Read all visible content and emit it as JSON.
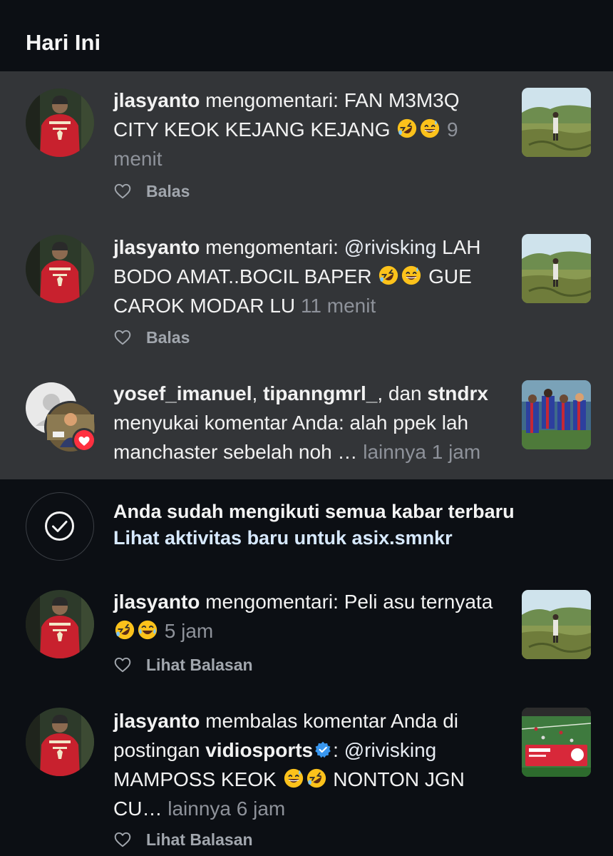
{
  "header": {
    "title": "Hari Ini"
  },
  "notifications": [
    {
      "user": "jlasyanto",
      "action": "mengomentari:",
      "body": "FAN M3M3Q CITY KEOK KEJANG KEJANG",
      "emojis": [
        "rolling-laugh",
        "sweat-smile"
      ],
      "time": "9 menit",
      "reply_label": "Balas"
    },
    {
      "user": "jlasyanto",
      "action": "mengomentari:",
      "mention": "@rivisking",
      "body_a": "LAH BODO AMAT..BOCIL BAPER",
      "emojis": [
        "rolling-laugh",
        "sweat-smile"
      ],
      "body_b": "GUE CAROK MODAR LU",
      "time": "11 menit",
      "reply_label": "Balas"
    },
    {
      "user1": "yosef_imanuel",
      "sep1": ",",
      "user2": "tipanngmrl_",
      "sep2": ", dan",
      "user3": "stndrx",
      "action": "menyukai komentar Anda:",
      "body": "alah ppek lah manchaster sebelah noh …",
      "more": "lainnya",
      "time": "1 jam"
    }
  ],
  "caught_up": {
    "title": "Anda sudah mengikuti semua kabar terbaru",
    "link": "Lihat aktivitas baru untuk asix.smnkr"
  },
  "older": [
    {
      "user": "jlasyanto",
      "action": "mengomentari:",
      "body": "Peli asu ternyata",
      "emojis": [
        "rolling-laugh",
        "joy"
      ],
      "time": "5 jam",
      "reply_label": "Lihat Balasan"
    },
    {
      "user": "jlasyanto",
      "action": "membalas komentar Anda di postingan",
      "account": "vidiosports",
      "colon": ":",
      "mention": "@rivisking",
      "body_a": "MAMPOSS KEOK",
      "emojis": [
        "sweat-smile",
        "rolling-laugh"
      ],
      "body_b": "NONTON JGN CU…",
      "more": "lainnya",
      "time": "6 jam",
      "reply_label": "Lihat Balasan"
    }
  ],
  "icons": {
    "heart": "heart-outline-icon",
    "check": "check-circle-icon",
    "verified": "verified-badge-icon",
    "liked": "heart-badge-icon"
  },
  "colors": {
    "background": "#0c0f14",
    "highlight": "#333538",
    "meta": "#8e929a",
    "link": "#d7e9ff",
    "like_badge": "#ff3040",
    "verified": "#3897f0"
  }
}
